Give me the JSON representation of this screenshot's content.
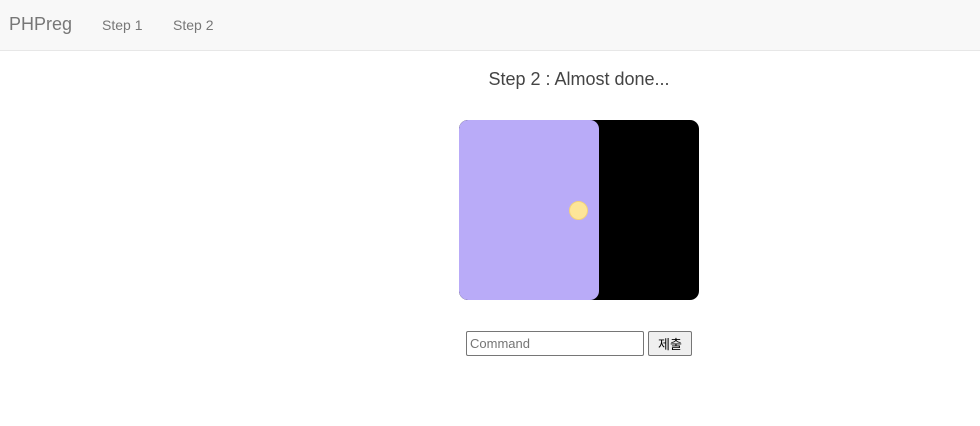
{
  "navbar": {
    "brand": "PHPreg",
    "links": [
      {
        "label": "Step 1"
      },
      {
        "label": "Step 2"
      }
    ]
  },
  "main": {
    "heading": "Step 2 : Almost done...",
    "door": {
      "panel_color": "#b9abf8",
      "frame_color": "#000000",
      "knob_color": "#fde598"
    },
    "command_form": {
      "input_value": "",
      "input_placeholder": "Command",
      "submit_label": "제출"
    }
  }
}
